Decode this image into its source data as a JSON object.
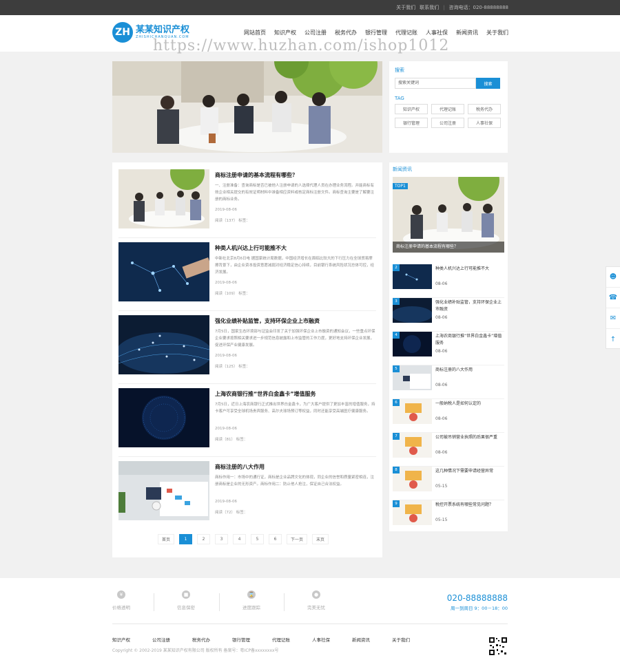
{
  "topbar": {
    "about": "关于我们",
    "contact": "联系我们",
    "hotline_label": "咨询电话：",
    "hotline": "020-88888888"
  },
  "logo": {
    "mark": "ZH",
    "title": "某某知识产权",
    "subtitle": "ZHISHICHANQUAN.COM"
  },
  "watermark": "https://www.huzhan.com/ishop1012",
  "nav": [
    "网站首页",
    "知识产权",
    "公司注册",
    "税务代办",
    "银行管理",
    "代理记账",
    "人事社保",
    "新闻资讯",
    "关于我们"
  ],
  "search": {
    "title": "搜索",
    "placeholder": "搜索关键词",
    "button": "搜索"
  },
  "tags": {
    "title": "TAG",
    "items": [
      "知识产权",
      "代理记账",
      "税务代办",
      "银行管理",
      "公司注册",
      "人事社保"
    ]
  },
  "articles": [
    {
      "title": "商标注册申请的基本流程有哪些？",
      "desc": "一、注册准备：查询商标是否已被他人注册申请的人选择代理人员在办理业务流程。并能商标有效企业相关提交的有效证明材料中准备相应资料或核定商标注册文件。商标查询主要是了解要注册的商标业务。",
      "date": "2019-08-06",
      "meta": "阅读（137） 标签："
    },
    {
      "title": "种类人机兴达上行可能推不大",
      "desc": "中新社北京8月6日电 据国家统计局数据，中国经济增长在面临比较大的下行压力在全球贸易摩擦背景下，由企业资本投资意愿减弱对经济稳定信心持续，目前银行系统风险状况总体可控，经济发展。",
      "date": "2019-08-06",
      "meta": "阅读（109） 标签："
    },
    {
      "title": "强化业绩补贴监管，支持环保企业上市融资",
      "desc": "7月5日，国家生态环境部与证监会印发了关于加强环保企业上市融资的通知会议，一些重点环保企业要求按照相关要求进一步规范信息披露和上市监管的工作力度，更好地支持环保企业发展，促进环保产业健康发展。",
      "date": "2019-08-06",
      "meta": "阅读（125） 标签："
    },
    {
      "title": "上海农商银行推“世界白金鑫卡”增值服务",
      "desc": "7月5日，近日上海农商银行正式推出世界白金鑫卡，为广大客户提供了更加丰富的增值服务，持卡客户可享受全球机场贵宾服务、高尔夫球场预订等权益，同时还能享受高端医疗健康服务。",
      "date": "2019-08-06",
      "meta": "阅读（81） 标签："
    },
    {
      "title": "商标注册的八大作用",
      "desc": "商标作用一：市场中的通行证，商标是企业品牌文化的体现，同企业的信誉和质量紧密相连，注册商标是企业的无形资产。商标作用二：防止他人抢注，保证自己合法权益。",
      "date": "2019-08-06",
      "meta": "阅读（72） 标签："
    }
  ],
  "pager": {
    "prev": "首页",
    "pages": [
      "1",
      "2",
      "3",
      "4",
      "5",
      "6"
    ],
    "next": "下一页",
    "last": "末页",
    "current": "1"
  },
  "news": {
    "title": "新闻资讯",
    "top1": {
      "badge": "TOP1",
      "caption": "商标注册申请的基本流程有哪些？"
    },
    "items": [
      {
        "num": "2",
        "title": "种类人机兴达上行可能推不大",
        "date": "08-06"
      },
      {
        "num": "3",
        "title": "强化业绩补贴监管，支持环保企业上市融资",
        "date": "08-06"
      },
      {
        "num": "4",
        "title": "上海农商银行推“世界白金鑫卡”增值服务",
        "date": "08-06"
      },
      {
        "num": "5",
        "title": "商标注册的八大作用",
        "date": "08-06"
      },
      {
        "num": "6",
        "title": "一般纳税人是如何认定的",
        "date": "08-06"
      },
      {
        "num": "7",
        "title": "公司被吊销营业执照的后果很严重",
        "date": "08-06"
      },
      {
        "num": "8",
        "title": "这几种情况下需要申请经营异常",
        "date": "05-15"
      },
      {
        "num": "9",
        "title": "税控开票系统有哪些常见问题？",
        "date": "05-15"
      }
    ]
  },
  "footer": {
    "features": [
      "价格透明",
      "信息保密",
      "进度跟踪",
      "完美无忧"
    ],
    "hotline": "020-88888888",
    "hours": "周一到周日 9：00－18：00",
    "links": [
      "知识产权",
      "公司注册",
      "税务代办",
      "银行管理",
      "代理记账",
      "人事社保",
      "新闻资讯",
      "关于我们"
    ],
    "copyright": "Copyright © 2002-2019 某某知识产权有限公司 版权所有 备案号：粤ICP备xxxxxxxx号"
  },
  "colors": {
    "accent": "#1a8fd6",
    "topbar": "#3d3d3d",
    "page_bg": "#f1f1f1"
  }
}
